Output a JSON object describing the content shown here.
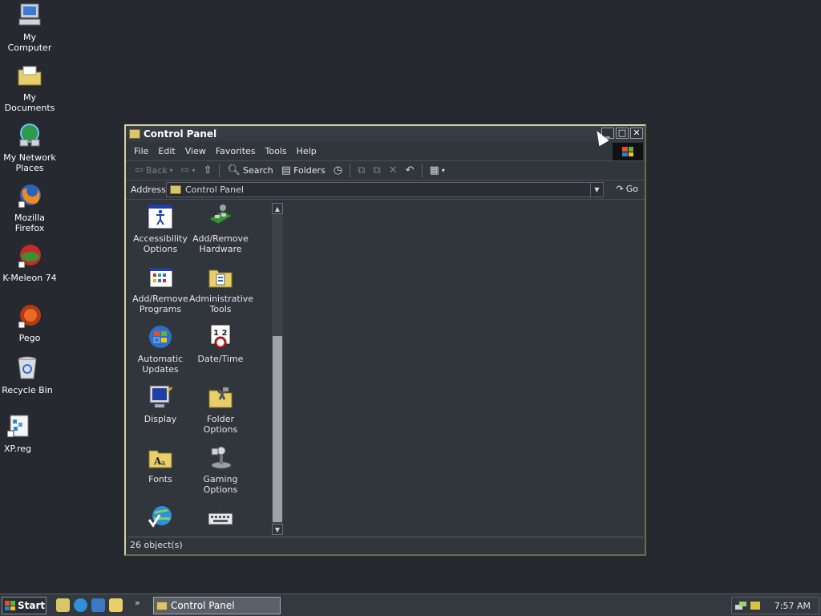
{
  "desktop": {
    "icons": [
      {
        "label": "My Computer",
        "icon": "computer-icon"
      },
      {
        "label": "My Documents",
        "icon": "documents-folder-icon"
      },
      {
        "label": "My Network Places",
        "icon": "network-icon"
      },
      {
        "label": "Mozilla Firefox",
        "icon": "firefox-icon"
      },
      {
        "label": "K-Meleon 74",
        "icon": "kmeleon-icon"
      },
      {
        "label": "Pego",
        "icon": "pego-icon"
      },
      {
        "label": "Recycle Bin",
        "icon": "recycle-bin-icon"
      },
      {
        "label": "XP.reg",
        "icon": "registry-file-icon"
      }
    ]
  },
  "window": {
    "title": "Control Panel",
    "menu": [
      "File",
      "Edit",
      "View",
      "Favorites",
      "Tools",
      "Help"
    ],
    "toolbar": {
      "back": "Back",
      "search": "Search",
      "folders": "Folders"
    },
    "address": {
      "label": "Address",
      "value": "Control Panel",
      "go": "Go"
    },
    "items": [
      {
        "label": "Accessibility Options",
        "icon": "accessibility-icon"
      },
      {
        "label": "Add/Remove Hardware",
        "icon": "hardware-icon"
      },
      {
        "label": "Add/Remove Programs",
        "icon": "programs-icon"
      },
      {
        "label": "Administrative Tools",
        "icon": "admin-tools-icon"
      },
      {
        "label": "Automatic Updates",
        "icon": "windows-update-icon"
      },
      {
        "label": "Date/Time",
        "icon": "calendar-clock-icon"
      },
      {
        "label": "Display",
        "icon": "display-icon"
      },
      {
        "label": "Folder Options",
        "icon": "folder-options-icon"
      },
      {
        "label": "Fonts",
        "icon": "fonts-folder-icon"
      },
      {
        "label": "Gaming Options",
        "icon": "joystick-icon"
      },
      {
        "label": "",
        "icon": "internet-options-icon"
      },
      {
        "label": "",
        "icon": "keyboard-icon"
      }
    ],
    "status": "26 object(s)"
  },
  "taskbar": {
    "start": "Start",
    "task": "Control Panel",
    "clock": "7:57 AM"
  },
  "colors": {
    "desktop_bg": "#26292f",
    "window_bg": "#31353c",
    "window_border": "#c9c08a"
  }
}
